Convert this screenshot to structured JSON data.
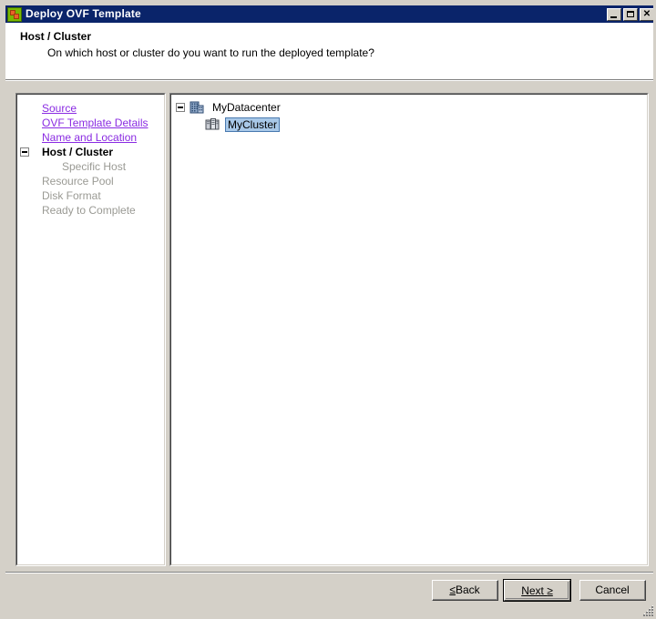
{
  "window": {
    "title": "Deploy OVF Template",
    "icon": "ovf-template-icon",
    "controls": {
      "minimize": "minimize-button",
      "maximize": "maximize-button",
      "close": "✕"
    }
  },
  "header": {
    "title": "Host / Cluster",
    "subtitle": "On which host or cluster do you want to run the deployed template?"
  },
  "nav": {
    "items": [
      {
        "label": "Source",
        "state": "link",
        "indent": 0
      },
      {
        "label": "OVF Template Details",
        "state": "link",
        "indent": 0
      },
      {
        "label": "Name and Location",
        "state": "link",
        "indent": 0
      },
      {
        "label": "Host / Cluster",
        "state": "current",
        "indent": 0,
        "toggle": "collapse-box"
      },
      {
        "label": "Specific Host",
        "state": "disabled",
        "indent": 1
      },
      {
        "label": "Resource Pool",
        "state": "disabled",
        "indent": 0
      },
      {
        "label": "Disk Format",
        "state": "disabled",
        "indent": 0
      },
      {
        "label": "Ready to Complete",
        "state": "disabled",
        "indent": 0
      }
    ]
  },
  "tree": {
    "nodes": [
      {
        "label": "MyDatacenter",
        "level": 0,
        "icon": "datacenter-icon",
        "expanded": true,
        "selected": false
      },
      {
        "label": "MyCluster",
        "level": 1,
        "icon": "cluster-icon",
        "expanded": false,
        "selected": true
      }
    ]
  },
  "footer": {
    "back": {
      "prefix": "≤",
      "label": " Back"
    },
    "next": {
      "label": "Next ",
      "suffix": "≥"
    },
    "cancel": {
      "label": "Cancel"
    }
  },
  "colors": {
    "titlebar": "#0a246a",
    "face": "#d4d0c8",
    "link": "#8a2be2",
    "selection": "#a8c8e8",
    "disabled_text": "#9a9a94"
  }
}
